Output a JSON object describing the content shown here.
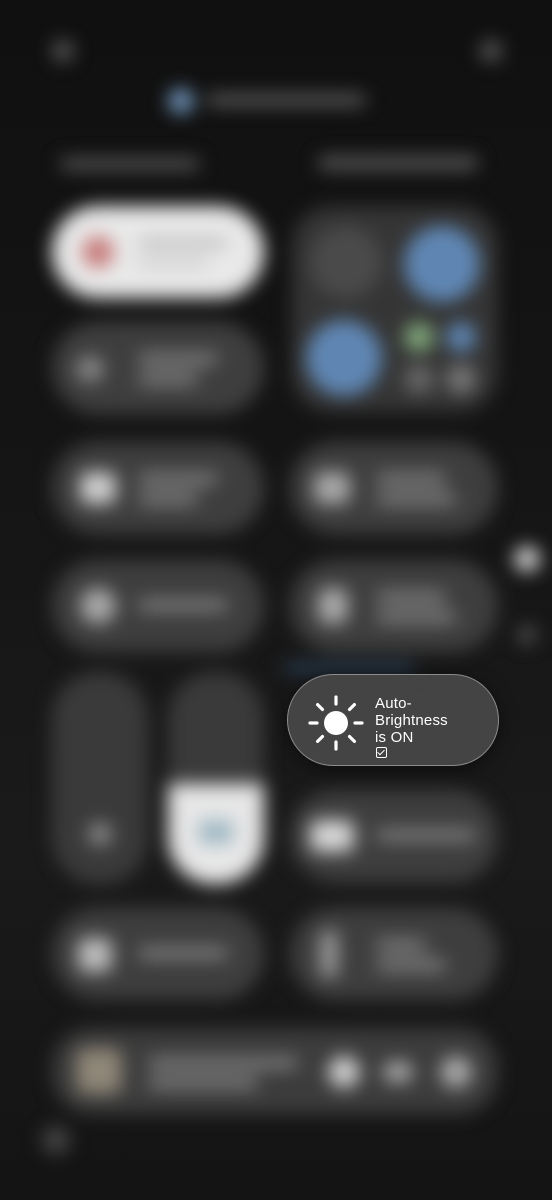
{
  "toast": {
    "line1": "Auto-",
    "line2": "Brightness",
    "line3": "is ON",
    "icon": "sun-icon"
  }
}
